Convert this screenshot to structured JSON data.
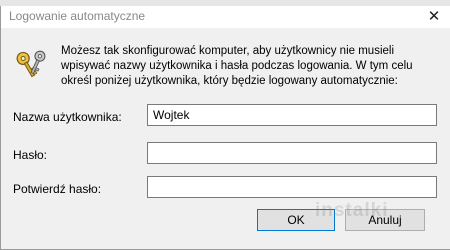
{
  "window": {
    "title": "Logowanie automatyczne"
  },
  "icons": {
    "close": "close-icon",
    "keys": "keys-icon"
  },
  "description": {
    "line1": "Możesz tak skonfigurować komputer, aby użytkownicy nie musieli",
    "line2": "wpisywać nazwy użytkownika i hasła podczas logowania. W tym celu",
    "line3": "określ poniżej użytkownika, który będzie logowany automatycznie:"
  },
  "form": {
    "username_label": "Nazwa użytkownika:",
    "username_value": "Wojtek",
    "password_label": "Hasło:",
    "password_value": "",
    "confirm_label": "Potwierdź hasło:",
    "confirm_value": ""
  },
  "buttons": {
    "ok_label": "OK",
    "cancel_label": "Anuluj"
  },
  "watermark": "instalki"
}
